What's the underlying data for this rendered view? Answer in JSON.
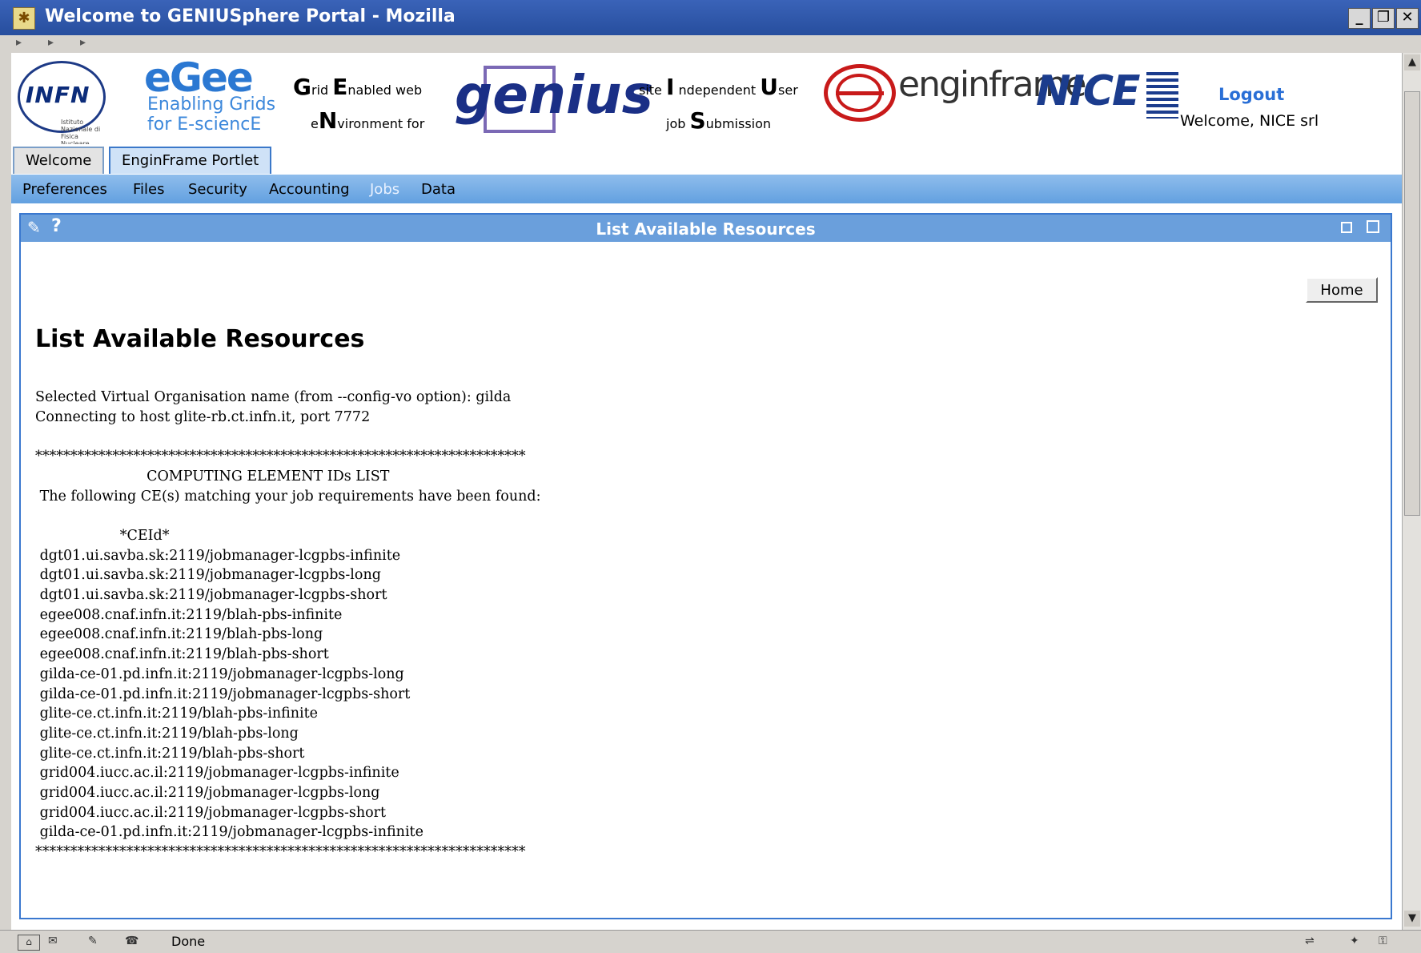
{
  "window": {
    "title": "Welcome to GENIUSphere Portal - Mozilla",
    "app_icon": "mozilla-icon",
    "controls": [
      "minimize",
      "restore",
      "close"
    ]
  },
  "navigation": {
    "arrows": [
      "▸",
      "▸",
      "▸"
    ]
  },
  "header": {
    "logos": {
      "infn": "INFN",
      "infn_sub": "Istituto Nazionale di Fisica Nucleare",
      "egee": "eGee",
      "egee_sub": [
        "Enabling Grids",
        "for E-sciencE"
      ],
      "genius": "genius",
      "enginframe": "enginframe",
      "nice": "NICE"
    },
    "genius_caption": {
      "line1_big1": "G",
      "line1_small1": "rid ",
      "line1_big2": "E",
      "line1_small2": "nabled web",
      "line2_small1": "e",
      "line2_big1": "N",
      "line2_small2": "vironment for"
    },
    "site_caption": {
      "line1_small1": "site ",
      "line1_big1": "I",
      "line1_small2": " ndependent ",
      "line1_big2": "U",
      "line1_small3": "ser",
      "line2_small1": "job ",
      "line2_big1": "S",
      "line2_small2": "ubmission"
    },
    "logout": "Logout",
    "welcome": "Welcome, NICE srl"
  },
  "tabs": [
    {
      "label": "Welcome",
      "active": false
    },
    {
      "label": "EnginFrame Portlet",
      "active": true
    }
  ],
  "menu": [
    {
      "label": "Preferences",
      "active": false
    },
    {
      "label": "Files",
      "active": false
    },
    {
      "label": "Security",
      "active": false
    },
    {
      "label": "Accounting",
      "active": false
    },
    {
      "label": "Jobs",
      "active": true
    },
    {
      "label": "Data",
      "active": false
    }
  ],
  "portlet": {
    "title": "List Available Resources",
    "help": "?",
    "home_button": "Home",
    "heading": "List Available Resources",
    "output": "Selected Virtual Organisation name (from --config-vo option): gilda\nConnecting to host glite-rb.ct.infn.it, port 7772\n\n**********************************************************************\n                         COMPUTING ELEMENT IDs LIST\n The following CE(s) matching your job requirements have been found:\n\n                   *CEId*\n dgt01.ui.savba.sk:2119/jobmanager-lcgpbs-infinite\n dgt01.ui.savba.sk:2119/jobmanager-lcgpbs-long\n dgt01.ui.savba.sk:2119/jobmanager-lcgpbs-short\n egee008.cnaf.infn.it:2119/blah-pbs-infinite\n egee008.cnaf.infn.it:2119/blah-pbs-long\n egee008.cnaf.infn.it:2119/blah-pbs-short\n gilda-ce-01.pd.infn.it:2119/jobmanager-lcgpbs-long\n gilda-ce-01.pd.infn.it:2119/jobmanager-lcgpbs-short\n glite-ce.ct.infn.it:2119/blah-pbs-infinite\n glite-ce.ct.infn.it:2119/blah-pbs-long\n glite-ce.ct.infn.it:2119/blah-pbs-short\n grid004.iucc.ac.il:2119/jobmanager-lcgpbs-infinite\n grid004.iucc.ac.il:2119/jobmanager-lcgpbs-long\n grid004.iucc.ac.il:2119/jobmanager-lcgpbs-short\n gilda-ce-01.pd.infn.it:2119/jobmanager-lcgpbs-infinite\n**********************************************************************"
  },
  "statusbar": {
    "text": "Done",
    "icons": [
      "navigator-icon",
      "mail-icon",
      "composer-icon",
      "address-book-icon",
      "connection-icon",
      "security-icon",
      "lock-icon"
    ]
  },
  "colors": {
    "titlebar": "#3a63b8",
    "menubar": "#6aa6e4",
    "portlet_border": "#3a78cf",
    "logout_link": "#2a6fd6"
  }
}
